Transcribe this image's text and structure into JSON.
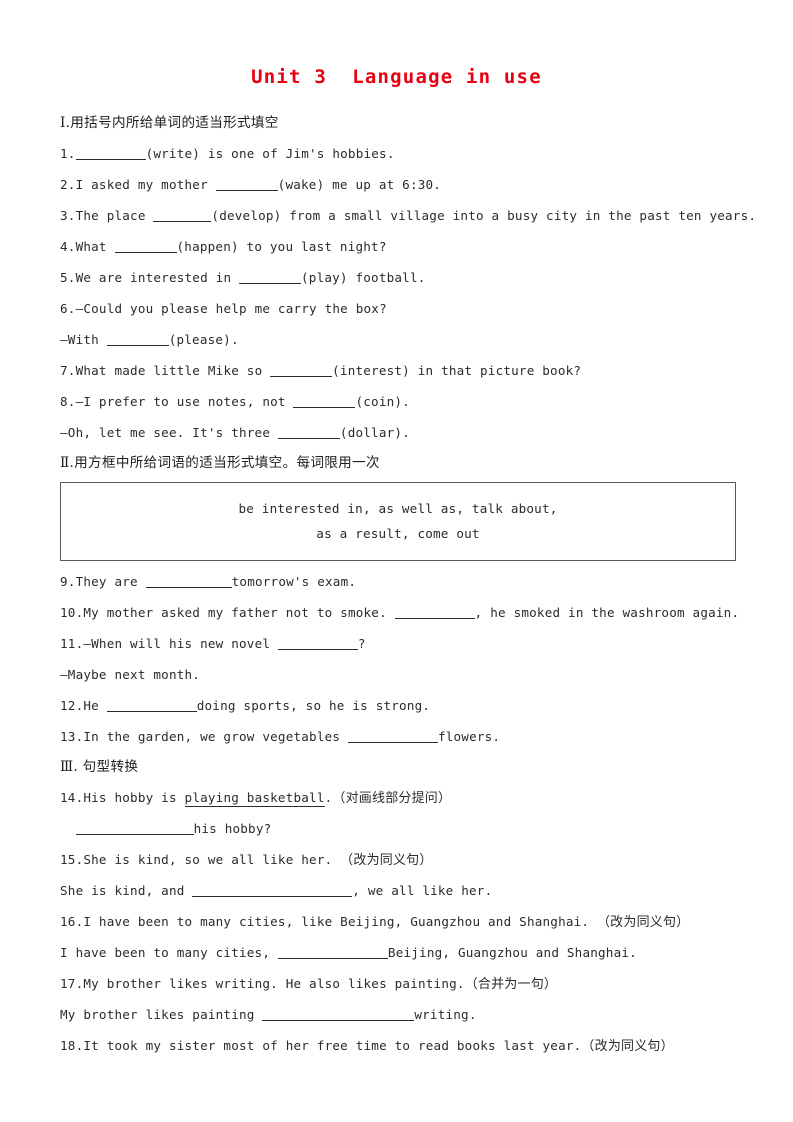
{
  "document": {
    "title": "Unit 3  Language in use",
    "title_color": "#e60012"
  },
  "sections": [
    {
      "id": "section-1",
      "heading": "Ⅰ.用括号内所给单词的适当形式填空",
      "items": [
        {
          "n": "1.",
          "pre": "",
          "post": "(write) is one of Jim's hobbies."
        },
        {
          "n": "2.",
          "pre": "I asked my mother ",
          "post": "(wake) me up at 6:30."
        },
        {
          "n": "3.",
          "pre": "The place ",
          "post": "(develop) from a small village into a busy city in the past ten years."
        },
        {
          "n": "4.",
          "pre": "What ",
          "post": "(happen) to you last night?"
        },
        {
          "n": "5.",
          "pre": "We are interested in ",
          "post": "(play) football."
        },
        {
          "n": "6.",
          "pre": "—Could you please help me carry the box?",
          "post": ""
        },
        {
          "n": "",
          "pre": "—With ",
          "post": "(please)."
        },
        {
          "n": "7.",
          "pre": "What made little Mike so ",
          "post": "(interest) in that picture book?"
        },
        {
          "n": "8.",
          "pre": "—I prefer to use notes, not ",
          "post": "(coin)."
        },
        {
          "n": "",
          "pre": "—Oh, let me see. It's three ",
          "post": "(dollar)."
        }
      ]
    },
    {
      "id": "section-2",
      "heading": "Ⅱ.用方框中所给词语的适当形式填空。每词限用一次",
      "word_bank": {
        "line1": "be interested in, as well as, talk about,",
        "line2": "as a result, come out"
      },
      "items": [
        {
          "n": "9.",
          "pre": "They are ",
          "post": "tomorrow's exam."
        },
        {
          "n": "10.",
          "pre": "My mother asked my father not to smoke. ",
          "post": ", he smoked in the washroom again."
        },
        {
          "n": "11.",
          "pre": "—When will his new novel ",
          "post": "?"
        },
        {
          "n": "",
          "pre": "—Maybe next month.",
          "post": ""
        },
        {
          "n": "12.",
          "pre": "He ",
          "post": "doing sports, so he is strong."
        },
        {
          "n": "13.",
          "pre": "In the garden, we grow vegetables ",
          "post": "flowers."
        }
      ]
    },
    {
      "id": "section-3",
      "heading": "Ⅲ. 句型转换",
      "items": [
        {
          "n": "14.",
          "prompt_pre": "His hobby is ",
          "prompt_underlined": "playing basketball",
          "prompt_post": ".",
          "prompt_cn": "（对画线部分提问）",
          "answer_pre": "",
          "answer_post": "his hobby?"
        },
        {
          "n": "15.",
          "prompt_pre": "She is kind, so we all like her. ",
          "prompt_underlined": "",
          "prompt_post": "",
          "prompt_cn": "（改为同义句）",
          "answer_pre": "She is kind, and ",
          "answer_post": ", we all like her."
        },
        {
          "n": "16.",
          "prompt_pre": "I have been to many cities, like Beijing, Guangzhou and Shanghai. ",
          "prompt_underlined": "",
          "prompt_post": "",
          "prompt_cn": "（改为同义句）",
          "answer_pre": "I have been to many cities, ",
          "answer_post": "Beijing, Guangzhou and Shanghai."
        },
        {
          "n": "17.",
          "prompt_pre": "My brother likes writing. He also likes painting.",
          "prompt_underlined": "",
          "prompt_post": "",
          "prompt_cn": "（合并为一句）",
          "answer_pre": "My brother likes painting ",
          "answer_post": "writing."
        },
        {
          "n": "18.",
          "prompt_pre": "It took my sister most of her free time to read books last year.",
          "prompt_underlined": "",
          "prompt_post": "",
          "prompt_cn": "（改为同义句）",
          "answer_pre": "",
          "answer_post": ""
        }
      ]
    }
  ]
}
